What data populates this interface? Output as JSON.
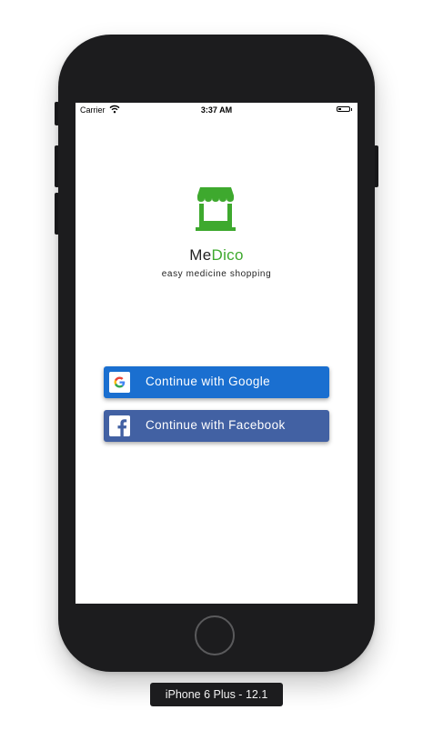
{
  "simulator": {
    "device_label": "iPhone 6 Plus - 12.1"
  },
  "status_bar": {
    "carrier": "Carrier",
    "time": "3:37 AM",
    "wifi_icon": "wifi-icon",
    "battery_icon": "battery-icon"
  },
  "app": {
    "logo_icon": "storefront-icon",
    "title_part_1": "Me",
    "title_part_2": "Dico",
    "tagline": "easy medicine shopping",
    "colors": {
      "brand_green": "#3ea92e"
    }
  },
  "auth": {
    "google": {
      "label": "Continue with Google",
      "icon": "google-icon",
      "color": "#1a6fd0"
    },
    "facebook": {
      "label": "Continue with Facebook",
      "icon": "facebook-icon",
      "color": "#4261a3"
    }
  }
}
